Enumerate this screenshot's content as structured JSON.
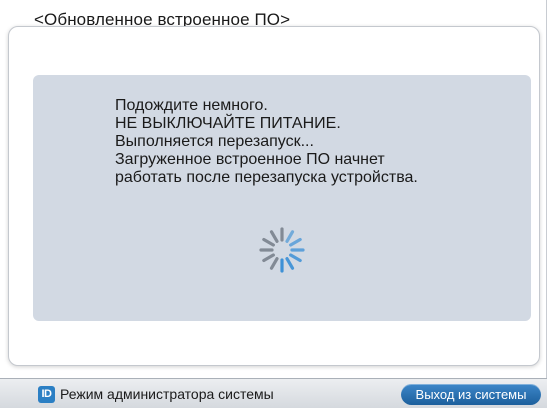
{
  "page": {
    "heading": "<Обновленное встроенное ПО>"
  },
  "dialog": {
    "message_lines": [
      "Подождите немного.",
      "НЕ ВЫКЛЮЧАЙТЕ ПИТАНИЕ.",
      "Выполняется перезапуск...",
      "Загруженное встроенное ПО начнет",
      "работать после перезапуска устройства."
    ],
    "spinner_icon": "loading-spinner-icon"
  },
  "status_bar": {
    "admin_icon_text": "ID",
    "admin_mode_label": "Режим администратора системы",
    "logout_label": "Выход из системы"
  },
  "colors": {
    "panel_bg": "#d2d9e3",
    "accent_blue": "#2b7fc4",
    "spinner_blue": "#3a8fd6",
    "spinner_gray": "#6f7782"
  }
}
